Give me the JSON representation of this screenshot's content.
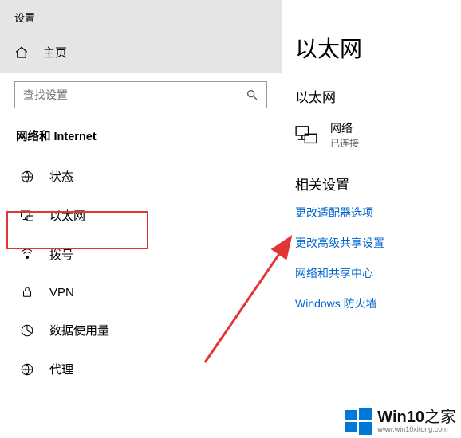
{
  "header": {
    "title": "设置"
  },
  "home": {
    "label": "主页"
  },
  "search": {
    "placeholder": "查找设置"
  },
  "category": {
    "label": "网络和 Internet"
  },
  "nav": {
    "items": [
      {
        "label": "状态"
      },
      {
        "label": "以太网"
      },
      {
        "label": "拨号"
      },
      {
        "label": "VPN"
      },
      {
        "label": "数据使用量"
      },
      {
        "label": "代理"
      }
    ]
  },
  "main": {
    "title": "以太网",
    "section_title": "以太网",
    "connection": {
      "name": "网络",
      "status": "已连接"
    },
    "related": {
      "heading": "相关设置",
      "links": [
        "更改适配器选项",
        "更改高级共享设置",
        "网络和共享中心",
        "Windows 防火墙"
      ]
    }
  },
  "watermark": {
    "brand": "Win10",
    "suffix": "之家",
    "url": "www.win10xitong.com"
  }
}
